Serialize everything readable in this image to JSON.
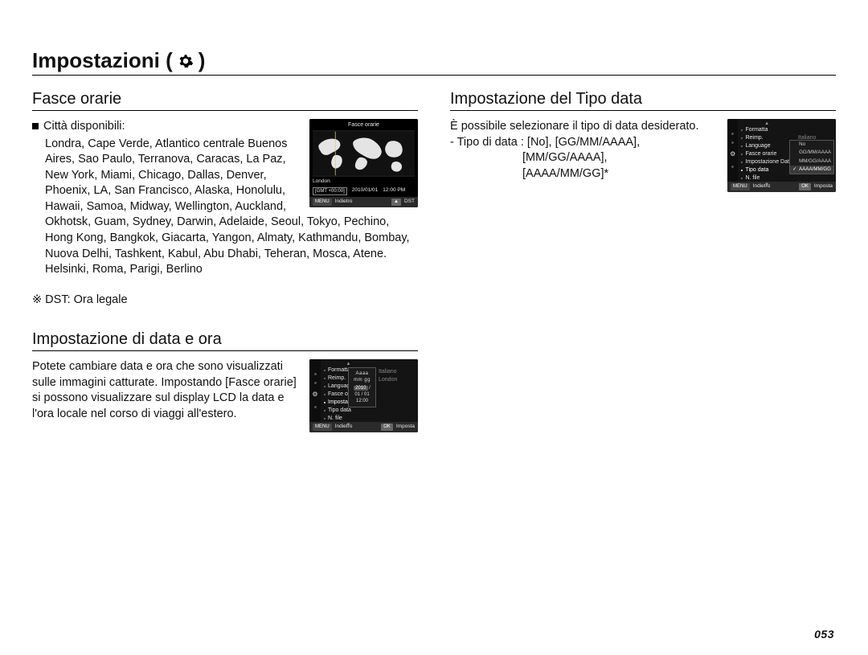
{
  "page_title_prefix": "Impostazioni (",
  "page_title_suffix": " )",
  "page_number": "053",
  "left": {
    "sec1_title": "Fasce orarie",
    "cities_label": "Città disponibili:",
    "cities_text": "Londra, Cape Verde, Atlantico centrale Buenos Aires, Sao Paulo, Terranova, Caracas, La Paz, New York, Miami, Chicago, Dallas, Denver, Phoenix, LA, San Francisco, Alaska, Honolulu, Hawaii, Samoa, Midway, Wellington, Auckland, Okhotsk, Guam, Sydney, Darwin, Adelaide, Seoul, Tokyo, Pechino, Hong Kong, Bangkok, Giacarta, Yangon, Almaty, Kathmandu, Bombay, Nuova Delhi, Tashkent, Kabul, Abu Dhabi, Teheran, Mosca, Atene. Helsinki, Roma, Parigi, Berlino",
    "dst_note": "※ DST: Ora legale",
    "sec2_title": "Impostazione di data e ora",
    "sec2_body": "Potete cambiare data e ora che sono visualizzati sulle immagini catturate. Impostando [Fasce orarie] si possono visualizzare sul display LCD la data e l'ora locale nel corso di viaggi all'estero.",
    "shot1": {
      "title": "Fasce orarie",
      "city": "London",
      "gmt": "[GMT +00:00]",
      "date": "2010/01/01",
      "time": "12:00 PM",
      "back_btn": "MENU",
      "back_label": "Indietro",
      "dst_btn": "▲",
      "dst_label": "DST"
    },
    "shot2": {
      "items": [
        "Formatta",
        "Reimp.",
        "Language",
        "Fasce orarie",
        "Impostazione D",
        "Tipo data",
        "N. file"
      ],
      "right_vals": [
        "",
        "",
        "Italiano",
        "London",
        "",
        "",
        ""
      ],
      "edit_label": "Aaaa mm gg",
      "edit_value_year": "2010",
      "edit_value_rest": " / 01 / 01   12:00",
      "back_btn": "MENU",
      "back_label": "Indietro",
      "ok_btn": "OK",
      "ok_label": "Imposta"
    }
  },
  "right": {
    "sec1_title": "Impostazione del Tipo data",
    "intro": "È possibile selezionare il tipo di data desiderato.",
    "tipo_line1": "- Tipo di data : [No], [GG/MM/AAAA],",
    "tipo_line2": "[MM/GG/AAAA],",
    "tipo_line3": "[AAAA/MM/GG]*",
    "shot3": {
      "items": [
        "Formatta",
        "Reimp.",
        "Language",
        "Fasce orarie",
        "Impostazione Data",
        "Tipo data",
        "N. file"
      ],
      "right_vals": [
        "",
        "",
        "Italiano",
        "",
        "",
        "",
        ""
      ],
      "popup": [
        "No",
        "GG/MM/AAAA",
        "MM/GG/AAAA",
        "AAAA/MM/GG"
      ],
      "popup_selected_index": 3,
      "back_btn": "MENU",
      "back_label": "Indietro",
      "ok_btn": "OK",
      "ok_label": "Imposta"
    }
  }
}
